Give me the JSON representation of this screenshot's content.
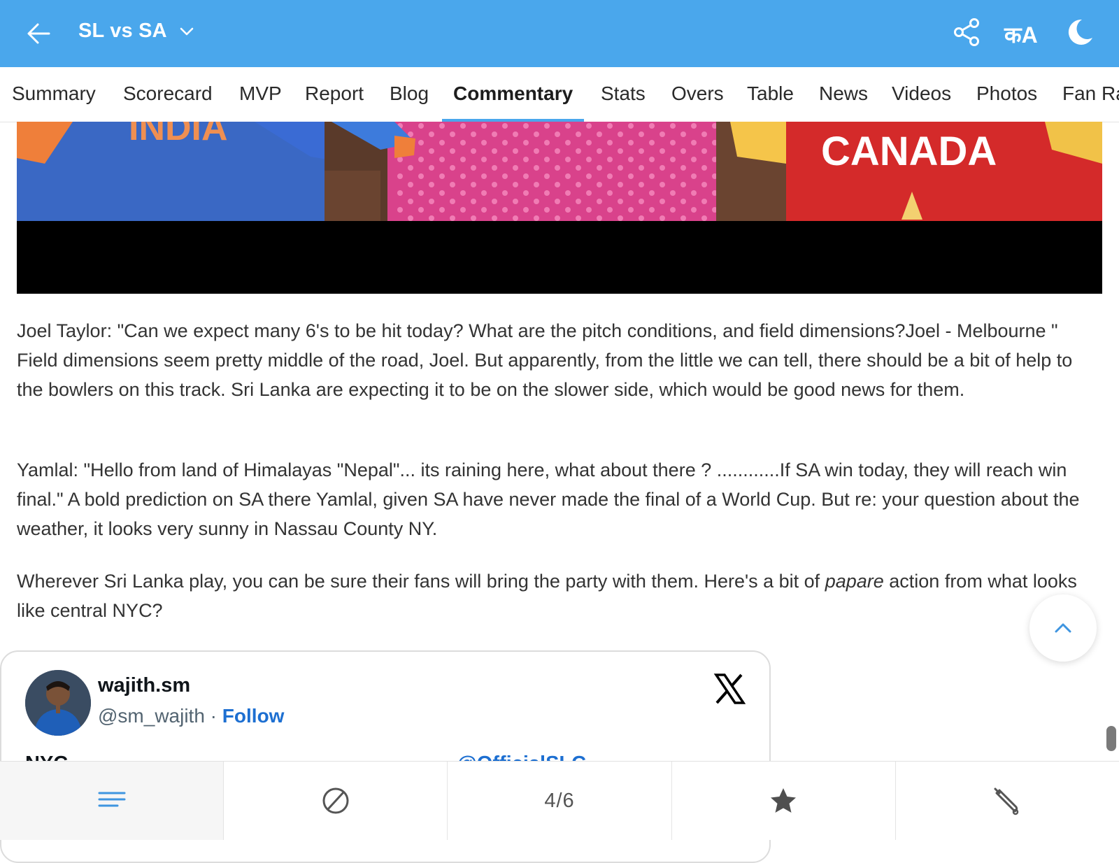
{
  "header": {
    "title": "SL vs SA",
    "lang_label": "कA"
  },
  "tabs": [
    {
      "label": "Summary"
    },
    {
      "label": "Scorecard"
    },
    {
      "label": "MVP"
    },
    {
      "label": "Report"
    },
    {
      "label": "Blog"
    },
    {
      "label": "Commentary",
      "active": true
    },
    {
      "label": "Stats"
    },
    {
      "label": "Overs"
    },
    {
      "label": "Table"
    },
    {
      "label": "News"
    },
    {
      "label": "Videos"
    },
    {
      "label": "Photos"
    },
    {
      "label": "Fan Ra"
    }
  ],
  "media": {
    "left_jersey_text": "INDIA",
    "right_jersey_text": "CANADA"
  },
  "article": {
    "p1": "Joel Taylor: \"Can we expect many 6's to be hit today? What are the pitch conditions, and field dimensions?Joel - Melbourne \" Field dimensions seem pretty middle of the road, Joel. But apparently, from the little we can tell, there should be a bit of help to the bowlers on this track. Sri Lanka are expecting it to be on the slower side, which would be good news for them.",
    "p2": "Yamlal: \"Hello from land of Himalayas \"Nepal\"... its raining here, what about there ? ............If SA win today, they will reach win final.\" A bold prediction on SA there Yamlal, given SA have never made the final of a World Cup. But re: your question about the weather, it looks very sunny in Nassau County NY.",
    "p3_before": "Wherever Sri Lanka play, you can be sure their fans will bring the party with them. Here's a bit of ",
    "p3_em": "papare",
    "p3_after": " action from what looks like central NYC?"
  },
  "tweet": {
    "name": "wajith.sm",
    "handle": "@sm_wajith",
    "separator": " · ",
    "follow": "Follow",
    "text_partial": "NYC_ _ _ _ _ _ _ _ _ _ _ _ _ _ _ _ _ _ _ _ _ _ _",
    "mention_partial": "@OfficialSLC"
  },
  "bottom_nav": {
    "page_indicator": "4/6"
  },
  "colors": {
    "brand_blue": "#4aa7ec",
    "link_blue": "#1d6fd1"
  }
}
